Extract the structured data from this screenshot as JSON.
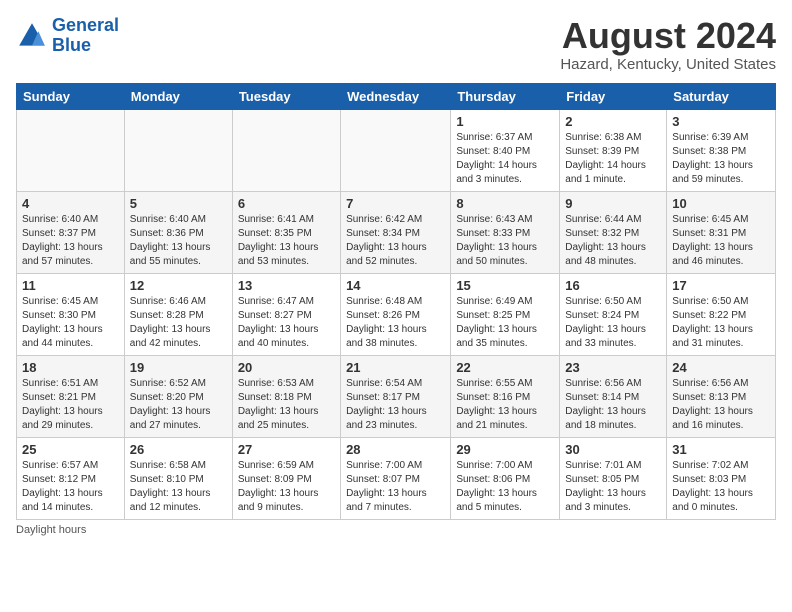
{
  "header": {
    "logo_line1": "General",
    "logo_line2": "Blue",
    "main_title": "August 2024",
    "subtitle": "Hazard, Kentucky, United States"
  },
  "days_of_week": [
    "Sunday",
    "Monday",
    "Tuesday",
    "Wednesday",
    "Thursday",
    "Friday",
    "Saturday"
  ],
  "weeks": [
    [
      {
        "day": "",
        "info": ""
      },
      {
        "day": "",
        "info": ""
      },
      {
        "day": "",
        "info": ""
      },
      {
        "day": "",
        "info": ""
      },
      {
        "day": "1",
        "info": "Sunrise: 6:37 AM\nSunset: 8:40 PM\nDaylight: 14 hours\nand 3 minutes."
      },
      {
        "day": "2",
        "info": "Sunrise: 6:38 AM\nSunset: 8:39 PM\nDaylight: 14 hours\nand 1 minute."
      },
      {
        "day": "3",
        "info": "Sunrise: 6:39 AM\nSunset: 8:38 PM\nDaylight: 13 hours\nand 59 minutes."
      }
    ],
    [
      {
        "day": "4",
        "info": "Sunrise: 6:40 AM\nSunset: 8:37 PM\nDaylight: 13 hours\nand 57 minutes."
      },
      {
        "day": "5",
        "info": "Sunrise: 6:40 AM\nSunset: 8:36 PM\nDaylight: 13 hours\nand 55 minutes."
      },
      {
        "day": "6",
        "info": "Sunrise: 6:41 AM\nSunset: 8:35 PM\nDaylight: 13 hours\nand 53 minutes."
      },
      {
        "day": "7",
        "info": "Sunrise: 6:42 AM\nSunset: 8:34 PM\nDaylight: 13 hours\nand 52 minutes."
      },
      {
        "day": "8",
        "info": "Sunrise: 6:43 AM\nSunset: 8:33 PM\nDaylight: 13 hours\nand 50 minutes."
      },
      {
        "day": "9",
        "info": "Sunrise: 6:44 AM\nSunset: 8:32 PM\nDaylight: 13 hours\nand 48 minutes."
      },
      {
        "day": "10",
        "info": "Sunrise: 6:45 AM\nSunset: 8:31 PM\nDaylight: 13 hours\nand 46 minutes."
      }
    ],
    [
      {
        "day": "11",
        "info": "Sunrise: 6:45 AM\nSunset: 8:30 PM\nDaylight: 13 hours\nand 44 minutes."
      },
      {
        "day": "12",
        "info": "Sunrise: 6:46 AM\nSunset: 8:28 PM\nDaylight: 13 hours\nand 42 minutes."
      },
      {
        "day": "13",
        "info": "Sunrise: 6:47 AM\nSunset: 8:27 PM\nDaylight: 13 hours\nand 40 minutes."
      },
      {
        "day": "14",
        "info": "Sunrise: 6:48 AM\nSunset: 8:26 PM\nDaylight: 13 hours\nand 38 minutes."
      },
      {
        "day": "15",
        "info": "Sunrise: 6:49 AM\nSunset: 8:25 PM\nDaylight: 13 hours\nand 35 minutes."
      },
      {
        "day": "16",
        "info": "Sunrise: 6:50 AM\nSunset: 8:24 PM\nDaylight: 13 hours\nand 33 minutes."
      },
      {
        "day": "17",
        "info": "Sunrise: 6:50 AM\nSunset: 8:22 PM\nDaylight: 13 hours\nand 31 minutes."
      }
    ],
    [
      {
        "day": "18",
        "info": "Sunrise: 6:51 AM\nSunset: 8:21 PM\nDaylight: 13 hours\nand 29 minutes."
      },
      {
        "day": "19",
        "info": "Sunrise: 6:52 AM\nSunset: 8:20 PM\nDaylight: 13 hours\nand 27 minutes."
      },
      {
        "day": "20",
        "info": "Sunrise: 6:53 AM\nSunset: 8:18 PM\nDaylight: 13 hours\nand 25 minutes."
      },
      {
        "day": "21",
        "info": "Sunrise: 6:54 AM\nSunset: 8:17 PM\nDaylight: 13 hours\nand 23 minutes."
      },
      {
        "day": "22",
        "info": "Sunrise: 6:55 AM\nSunset: 8:16 PM\nDaylight: 13 hours\nand 21 minutes."
      },
      {
        "day": "23",
        "info": "Sunrise: 6:56 AM\nSunset: 8:14 PM\nDaylight: 13 hours\nand 18 minutes."
      },
      {
        "day": "24",
        "info": "Sunrise: 6:56 AM\nSunset: 8:13 PM\nDaylight: 13 hours\nand 16 minutes."
      }
    ],
    [
      {
        "day": "25",
        "info": "Sunrise: 6:57 AM\nSunset: 8:12 PM\nDaylight: 13 hours\nand 14 minutes."
      },
      {
        "day": "26",
        "info": "Sunrise: 6:58 AM\nSunset: 8:10 PM\nDaylight: 13 hours\nand 12 minutes."
      },
      {
        "day": "27",
        "info": "Sunrise: 6:59 AM\nSunset: 8:09 PM\nDaylight: 13 hours\nand 9 minutes."
      },
      {
        "day": "28",
        "info": "Sunrise: 7:00 AM\nSunset: 8:07 PM\nDaylight: 13 hours\nand 7 minutes."
      },
      {
        "day": "29",
        "info": "Sunrise: 7:00 AM\nSunset: 8:06 PM\nDaylight: 13 hours\nand 5 minutes."
      },
      {
        "day": "30",
        "info": "Sunrise: 7:01 AM\nSunset: 8:05 PM\nDaylight: 13 hours\nand 3 minutes."
      },
      {
        "day": "31",
        "info": "Sunrise: 7:02 AM\nSunset: 8:03 PM\nDaylight: 13 hours\nand 0 minutes."
      }
    ]
  ],
  "footer": {
    "note": "Daylight hours"
  }
}
